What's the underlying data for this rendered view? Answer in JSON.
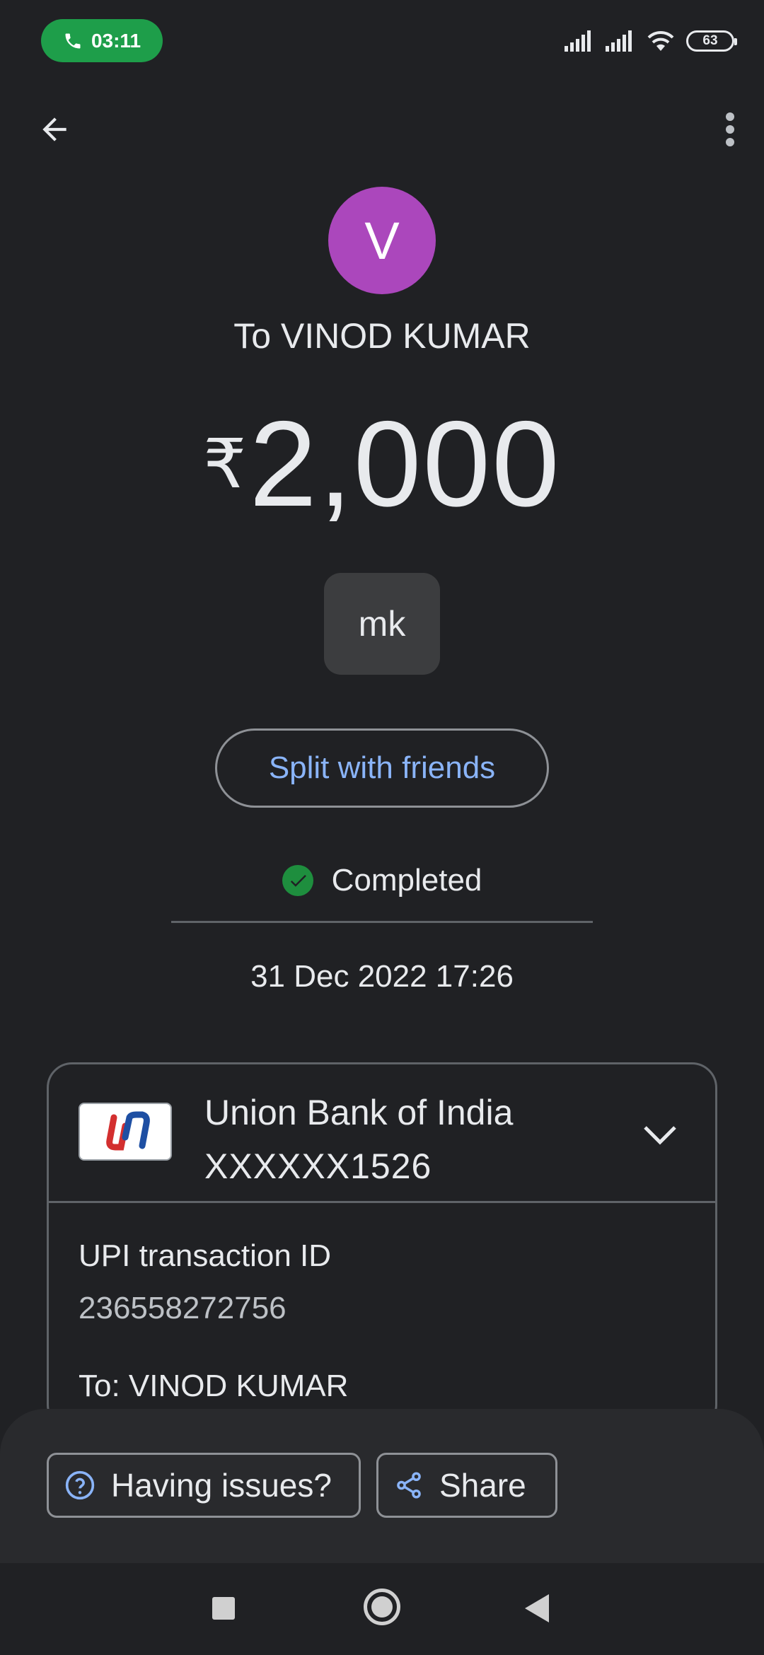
{
  "status_bar": {
    "call_time": "03:11",
    "battery": "63",
    "call_color": "#1e9e4a"
  },
  "app_bar": {
    "back_icon": "arrow-left-icon",
    "menu_icon": "more-vert-icon"
  },
  "payee": {
    "initial": "V",
    "label": "To VINOD KUMAR",
    "avatar_color": "#ab47bc"
  },
  "amount": {
    "currency": "₹",
    "value": "2,000"
  },
  "note": "mk",
  "split_button": "Split with friends",
  "status": {
    "label": "Completed",
    "icon": "check-circle-icon",
    "color": "#1e8e3e"
  },
  "datetime": "31 Dec 2022 17:26",
  "bank": {
    "name": "Union Bank of India",
    "account": "XXXXXX1526"
  },
  "details": {
    "txn_label": "UPI transaction ID",
    "txn_id": "236558272756",
    "to_label": "To: VINOD KUMAR"
  },
  "actions": {
    "issues": "Having issues?",
    "share": "Share",
    "accent": "#8ab4f8"
  }
}
